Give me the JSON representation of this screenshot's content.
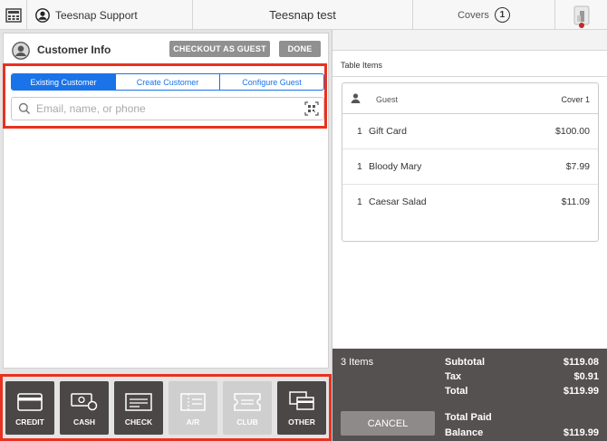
{
  "topbar": {
    "user_name": "Teesnap Support",
    "title": "Teesnap test",
    "covers_label": "Covers",
    "covers_count": "1"
  },
  "customer": {
    "title": "Customer Info",
    "checkout_guest_label": "CHECKOUT AS GUEST",
    "done_label": "DONE",
    "tabs": [
      {
        "label": "Existing Customer",
        "active": true
      },
      {
        "label": "Create Customer",
        "active": false
      },
      {
        "label": "Configure Guest",
        "active": false
      }
    ],
    "search_placeholder": "Email, name, or phone"
  },
  "payments": [
    {
      "label": "CREDIT",
      "icon": "credit-card-icon",
      "enabled": true
    },
    {
      "label": "CASH",
      "icon": "cash-icon",
      "enabled": true
    },
    {
      "label": "CHECK",
      "icon": "check-icon",
      "enabled": true
    },
    {
      "label": "A/R",
      "icon": "ar-icon",
      "enabled": false
    },
    {
      "label": "CLUB",
      "icon": "club-icon",
      "enabled": false
    },
    {
      "label": "OTHER",
      "icon": "other-icon",
      "enabled": true
    }
  ],
  "table": {
    "header": "Table Items",
    "guest_label": "Guest",
    "cover_label": "Cover 1",
    "items": [
      {
        "qty": "1",
        "name": "Gift Card",
        "price": "$100.00"
      },
      {
        "qty": "1",
        "name": "Bloody Mary",
        "price": "$7.99"
      },
      {
        "qty": "1",
        "name": "Caesar Salad",
        "price": "$11.09"
      }
    ]
  },
  "summary": {
    "items_count": "3 Items",
    "subtotal_label": "Subtotal",
    "subtotal": "$119.08",
    "tax_label": "Tax",
    "tax": "$0.91",
    "total_label": "Total",
    "total": "$119.99",
    "cancel_label": "CANCEL",
    "total_paid_label": "Total Paid",
    "total_paid": "",
    "balance_label": "Balance",
    "balance": "$119.99"
  },
  "colors": {
    "accent": "#1a73e8",
    "highlight": "#e8321f",
    "dark_button": "#4a4746",
    "summary_bg": "#555150"
  }
}
